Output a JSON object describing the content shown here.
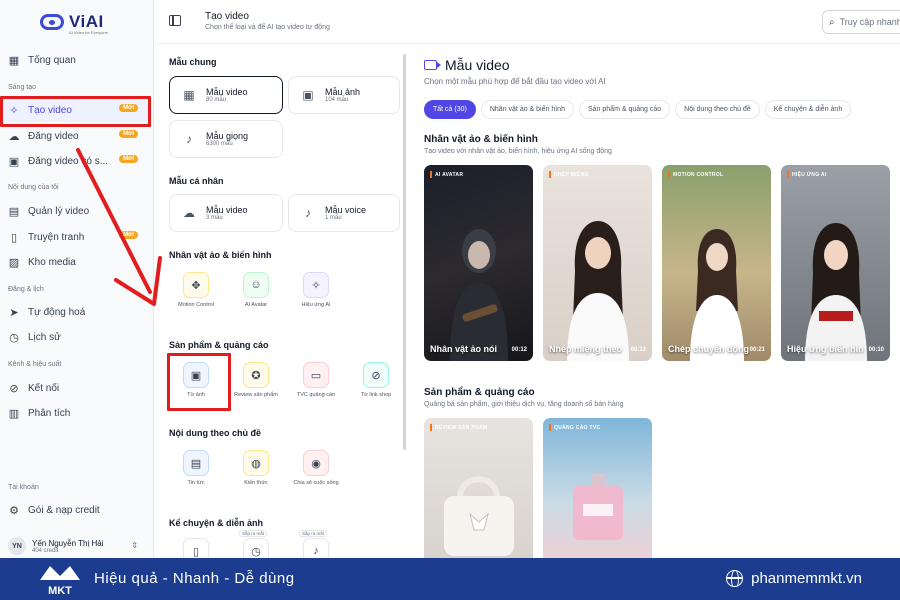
{
  "brand": {
    "name": "ViAI",
    "tagline": "AI Video for Everyone"
  },
  "sidebar": {
    "items": [
      {
        "label": "Tổng quan",
        "icon": "grid-icon"
      },
      {
        "label": "Tạo video",
        "icon": "sparkle-icon",
        "badge": "Mới",
        "active": true
      },
      {
        "label": "Đăng video",
        "icon": "upload-cloud-icon",
        "badge": "Mới"
      },
      {
        "label": "Đăng video có s...",
        "icon": "video-schedule-icon",
        "badge": "Mới"
      },
      {
        "label": "Quản lý video",
        "icon": "film-icon"
      },
      {
        "label": "Truyện tranh",
        "icon": "book-icon",
        "badge": "Mới"
      },
      {
        "label": "Kho media",
        "icon": "image-library-icon"
      },
      {
        "label": "Tự động hoá",
        "icon": "send-icon"
      },
      {
        "label": "Lịch sử",
        "icon": "clock-icon"
      },
      {
        "label": "Kết nối",
        "icon": "link-icon"
      },
      {
        "label": "Phân tích",
        "icon": "bar-chart-icon"
      },
      {
        "label": "Gói & nạp credit",
        "icon": "gear-icon"
      }
    ],
    "sections": {
      "create": "Sáng tạo",
      "content": "Nội dung của tôi",
      "publish": "Đăng & lịch",
      "channels": "Kênh & hiệu suất",
      "account": "Tài khoản"
    },
    "user": {
      "initials": "YN",
      "name": "Yến Nguyễn Thị Hải",
      "credit": "404 credit"
    }
  },
  "header": {
    "title": "Tạo video",
    "subtitle": "Chọn thể loại và để AI tạo video tự động",
    "search_placeholder": "Truy cập nhanh"
  },
  "middle": {
    "common_head": "Mẫu chung",
    "personal_head": "Mẫu cá nhân",
    "avatar_head": "Nhân vật ảo & biến hình",
    "product_head": "Sản phẩm & quảng cáo",
    "topic_head": "Nội dung theo chủ đề",
    "story_head": "Kể chuyện & diễn ảnh",
    "common": [
      {
        "title": "Mẫu video",
        "sub": "80 mẫu",
        "icon": "grid-icon"
      },
      {
        "title": "Mẫu ảnh",
        "sub": "104 mẫu",
        "icon": "image-icon"
      },
      {
        "title": "Mẫu giọng",
        "sub": "6300 mẫu",
        "icon": "microphone-icon"
      }
    ],
    "personal": [
      {
        "title": "Mẫu video",
        "sub": "3 mẫu",
        "icon": "upload-cloud-icon"
      },
      {
        "title": "Mẫu voice",
        "sub": "1 mẫu",
        "icon": "microphone-icon"
      }
    ],
    "avatar_tools": [
      {
        "label": "Motion Control",
        "icon": "move-icon"
      },
      {
        "label": "AI Avatar",
        "icon": "avatar-icon"
      },
      {
        "label": "Hiệu ứng AI",
        "icon": "sparkle-icon"
      }
    ],
    "product_tools": [
      {
        "label": "Từ ảnh",
        "icon": "image-icon"
      },
      {
        "label": "Review sản phẩm",
        "icon": "star-icon"
      },
      {
        "label": "TVC quảng cáo",
        "icon": "tv-icon"
      },
      {
        "label": "Từ link shop",
        "icon": "link-icon"
      }
    ],
    "topic_tools": [
      {
        "label": "Tin tức",
        "icon": "news-icon"
      },
      {
        "label": "Kiến thức",
        "icon": "lightbulb-icon"
      },
      {
        "label": "Chia sẻ cuộc sống",
        "icon": "camera-icon"
      }
    ],
    "story_tools": [
      {
        "label": "",
        "icon": "book-icon"
      },
      {
        "label": "Sắp ra mắt",
        "icon": "clock-icon"
      },
      {
        "label": "Sắp ra mắt",
        "icon": "music-icon"
      }
    ]
  },
  "content": {
    "title": "Mẫu video",
    "subtitle": "Chọn một mẫu phù hợp để bắt đầu tạo video với AI",
    "chips": [
      "Tất cả (30)",
      "Nhân vật ảo & biến hình",
      "Sản phẩm & quảng cáo",
      "Nội dung theo chủ đề",
      "Kể chuyện & diễn ảnh"
    ],
    "section1": {
      "title": "Nhân vật ảo & biến hình",
      "sub": "Tạo video với nhân vật ảo, biến hình, hiệu ứng AI sống động"
    },
    "section2": {
      "title": "Sản phẩm & quảng cáo",
      "sub": "Quảng bá sản phẩm, giới thiệu dịch vụ, tăng doanh số bán hàng"
    },
    "cards1": [
      {
        "tag": "AI AVATAR",
        "caption": "Nhân vật ảo nói",
        "duration": "00:12"
      },
      {
        "tag": "NHÉP MIỆNG",
        "caption": "Nhép miệng theo",
        "duration": "00:12"
      },
      {
        "tag": "MOTION CONTROL",
        "caption": "Chép chuyển động",
        "duration": "00:21"
      },
      {
        "tag": "HIỆU ỨNG AI",
        "caption": "Hiệu ứng biến hìn",
        "duration": "00:10"
      }
    ],
    "cards2": [
      {
        "tag": "REVIEW SẢN PHẨM"
      },
      {
        "tag": "QUẢNG CÁO TVC"
      }
    ]
  },
  "footer": {
    "slogan": "Hiệu quả - Nhanh - Dễ dùng",
    "site": "phanmemmkt.vn",
    "logo_text": "MKT"
  },
  "colors": {
    "accent": "#4f46e5",
    "badge": "#f6a623",
    "footer": "#1c3d8f",
    "highlight": "#e11d1d"
  }
}
